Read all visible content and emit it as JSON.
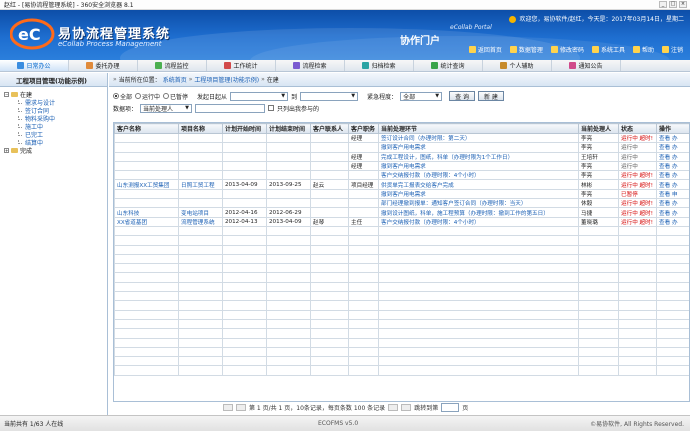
{
  "window": {
    "title": "赵红 - [易协流程管理系统] - 360安全浏览器 8.1"
  },
  "banner": {
    "brand_cn": "易协流程管理系统",
    "brand_en": "eCollab Process Management",
    "portal_en": "eCollab Portal",
    "portal_cn": "协作门户",
    "welcome": "欢迎您，易协软件/赵红，今天是：2017年03月14日，星期二"
  },
  "toplinks": [
    {
      "label": "返回首页",
      "icon": "home-icon"
    },
    {
      "label": "数据管理",
      "icon": "database-icon"
    },
    {
      "label": "修改密码",
      "icon": "key-icon"
    },
    {
      "label": "系统工具",
      "icon": "tools-icon"
    },
    {
      "label": "帮助",
      "icon": "help-icon"
    },
    {
      "label": "注销",
      "icon": "logout-icon"
    }
  ],
  "nav": [
    {
      "label": "日常办公",
      "icon": "office-icon"
    },
    {
      "label": "委托办理",
      "icon": "delegate-icon"
    },
    {
      "label": "流程监控",
      "icon": "monitor-icon"
    },
    {
      "label": "工作统计",
      "icon": "stats-icon"
    },
    {
      "label": "流程检索",
      "icon": "search-icon"
    },
    {
      "label": "归档检索",
      "icon": "archive-icon"
    },
    {
      "label": "统计查询",
      "icon": "query-icon"
    },
    {
      "label": "个人辅助",
      "icon": "person-icon"
    },
    {
      "label": "通知公告",
      "icon": "notice-icon"
    }
  ],
  "sidebar": {
    "title": "工程项目管理(功能示例)",
    "root": "在建",
    "children": [
      "需求与设计",
      "签订合同",
      "物料采购中",
      "施工中",
      "已完工",
      "结算中"
    ],
    "root2": "完成"
  },
  "breadcrumb": {
    "prefix": "当前所在位置：",
    "items": [
      "系统首页",
      "工程项目管理(功能示例)",
      "在建"
    ]
  },
  "filters": {
    "radios": [
      "全部",
      "运行中",
      "已暂停"
    ],
    "date_label": "发起日起从",
    "date_to": "到",
    "urgency_label": "紧急程度：",
    "urgency_value": "全部",
    "query_btn": "查 询",
    "new_btn": "新 建",
    "filter_label": "数据项：",
    "filter_value": "当前处理人",
    "only_mine": "只列出我参与的"
  },
  "table": {
    "headers": [
      "客户名称",
      "项目名称",
      "计划开始时间",
      "计划结束时间",
      "客户联系人",
      "客户职务",
      "当前处理环节",
      "当前处理人",
      "状态",
      "操作"
    ],
    "rows": [
      [
        "",
        "",
        "",
        "",
        "",
        "经理",
        "签订设计合同（办理时限：第二天）",
        "李亮",
        "运行中 超时!",
        "查看 办"
      ],
      [
        "",
        "",
        "",
        "",
        "",
        "",
        "撤到客户用电需求",
        "李亮",
        "运行中",
        "查看 办"
      ],
      [
        "",
        "",
        "",
        "",
        "",
        "经理",
        "完成工程设计，图纸，科单（办理时限为1个工作日）",
        "王培轩",
        "运行中",
        "查看 办"
      ],
      [
        "",
        "",
        "",
        "",
        "",
        "经理",
        "撤到客户用电需求",
        "李亮",
        "运行中",
        "查看 办"
      ],
      [
        "",
        "",
        "",
        "",
        "",
        "",
        "客户交纳报付款（办理时限：4个小时）",
        "李亮",
        "运行中 超时!",
        "查看 办"
      ],
      [
        "山东测报XX工贸集团",
        "日照工贸工程",
        "2013-04-09",
        "2013-09-25",
        "赵云",
        "项目经理",
        "供货单完工报表交给客户完成",
        "林彬",
        "运行中 超时!",
        "查看 办"
      ],
      [
        "",
        "",
        "",
        "",
        "",
        "",
        "撤到客户用电需求",
        "李亮",
        "已暂停",
        "查看 申"
      ],
      [
        "",
        "",
        "",
        "",
        "",
        "",
        "部门经理撤到报单：通知客户签订合同（办理时限：当天）",
        "休毅",
        "运行中 超时!",
        "查看 办"
      ],
      [
        "山东科技",
        "变电站项目",
        "2012-04-16",
        "2012-06-29",
        "",
        "",
        "撤到设计图纸，科单，施工程预算（办理时限：撤到工作的第五日）",
        "马捷",
        "运行中 超时!",
        "查看 办"
      ],
      [
        "XX省道基团",
        "流程管理系统",
        "2012-04-13",
        "2013-04-09",
        "赵琴",
        "主任",
        "客户交纳报付款（办理时限：4个小时）",
        "董晓璐",
        "运行中 超时!",
        "查看 办"
      ]
    ],
    "empty_rows": 16
  },
  "pager": {
    "text": "第 1 页/共 1 页，10条记录，每页条数 100 条记录",
    "goto_label": "跳转到第",
    "goto_suffix": "页"
  },
  "statusbar": {
    "left": "当前共有 1/63 人在线",
    "mid": "ECOFMS v5.0",
    "right": "©易协软件, All Rights Reserved."
  },
  "colors": {
    "banner": "#1e6ed0",
    "overdue": "#d40000",
    "link": "#1a5fb4"
  }
}
